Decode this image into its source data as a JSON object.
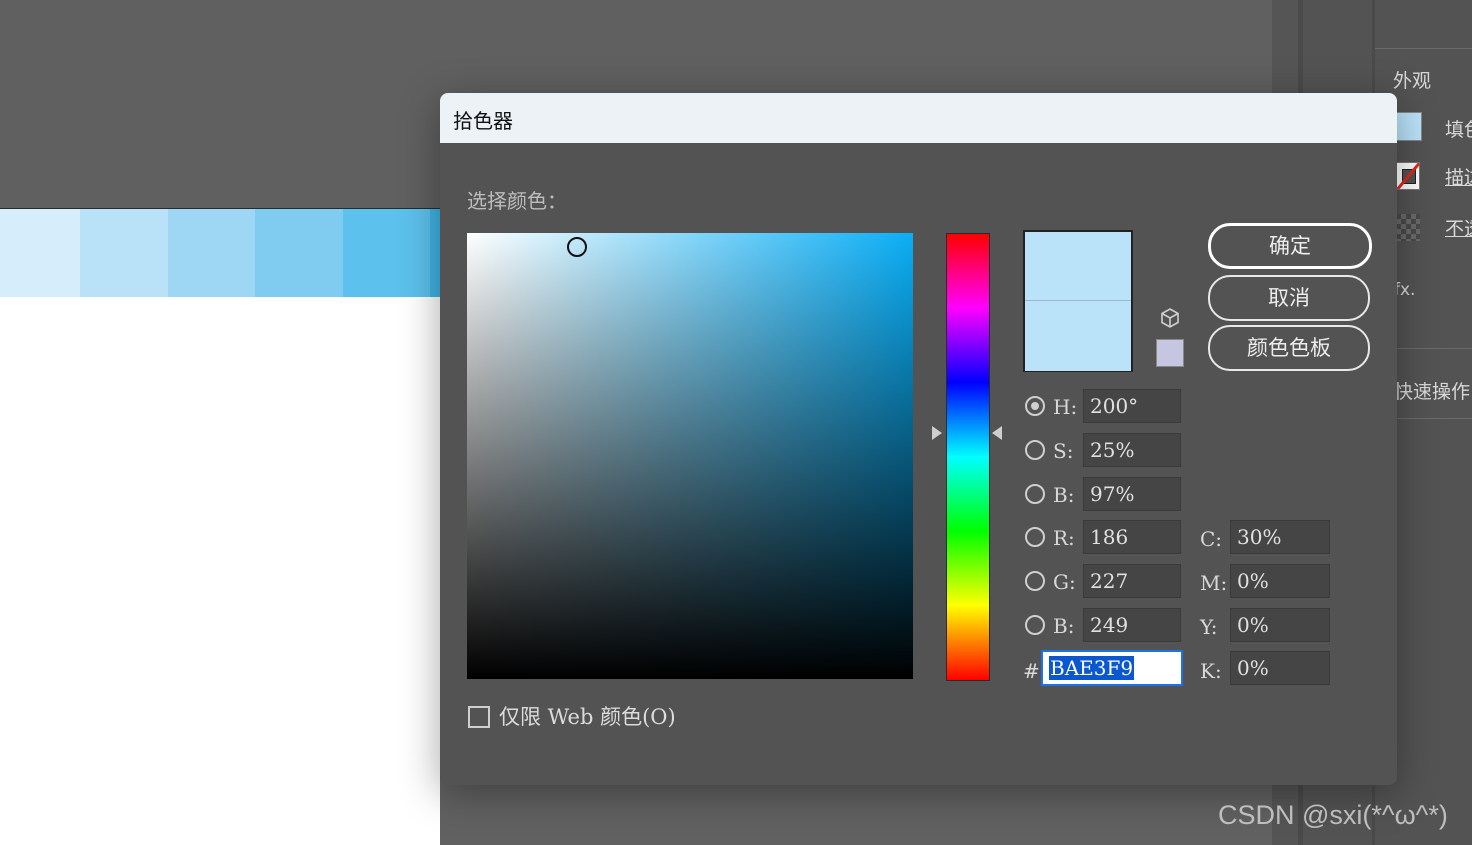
{
  "dialog": {
    "title": "拾色器",
    "choose_label": "选择颜色：",
    "buttons": {
      "ok": "确定",
      "cancel": "取消",
      "swatches": "颜色色板"
    },
    "fields": {
      "hsb": [
        {
          "label": "H:",
          "value": "200°",
          "selected": true
        },
        {
          "label": "S:",
          "value": "25%",
          "selected": false
        },
        {
          "label": "B:",
          "value": "97%",
          "selected": false
        }
      ],
      "rgb": [
        {
          "label": "R:",
          "value": "186",
          "selected": false
        },
        {
          "label": "G:",
          "value": "227",
          "selected": false
        },
        {
          "label": "B:",
          "value": "249",
          "selected": false
        }
      ],
      "cmyk": [
        {
          "label": "C:",
          "value": "30%"
        },
        {
          "label": "M:",
          "value": "0%"
        },
        {
          "label": "Y:",
          "value": "0%"
        },
        {
          "label": "K:",
          "value": "0%"
        }
      ],
      "hex_label": "#",
      "hex_value": "BAE3F9"
    },
    "web_only_label": "仅限 Web 颜色(O)",
    "web_only_checked": false,
    "colors": {
      "new_color": "#bae3f9",
      "current_color": "#bae3f9",
      "web_safe_color": "#c6c6e3",
      "field_hue": "#0aaef6"
    }
  },
  "side_panel": {
    "appearance": "外观",
    "fill": "填色",
    "stroke": "描边",
    "opacity": "不透明度",
    "fx": "fx.",
    "quick_actions": "快速操作"
  },
  "canvas": {
    "swatch_colors": [
      "#d6eefb",
      "#b9e2f8",
      "#9dd7f4",
      "#80cbf0",
      "#5cc1ec",
      "#3fb4e6"
    ]
  },
  "watermark": "CSDN @sxi(*^ω^*)"
}
